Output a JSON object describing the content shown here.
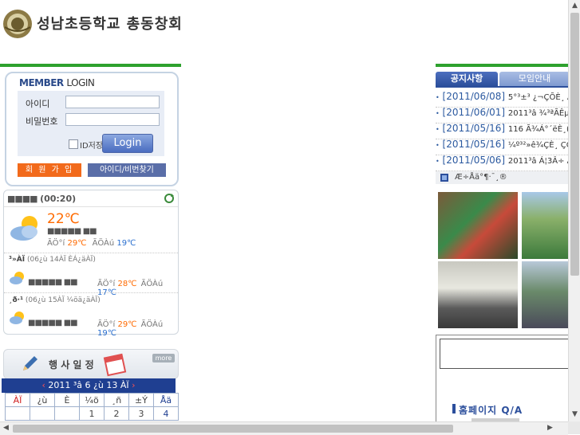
{
  "header": {
    "site_title": "성남초등학교 총동창회"
  },
  "login": {
    "title_member": "MEMBER",
    "title_login": "LOGIN",
    "id_label": "아이디",
    "pw_label": "비밀번호",
    "save_id_label": "ID저장",
    "login_button": "Login",
    "join_button": "회 원 가 입",
    "find_button": "아이디/비번찾기"
  },
  "weather": {
    "header_label": "■■■■",
    "header_time": "(00:20)",
    "today": {
      "temp": "22℃",
      "desc": "■■■■■ ■■",
      "hi_label": "ÃÖ°í",
      "hi": "29℃",
      "lo_label": "ÃÖÀú",
      "lo": "19℃"
    },
    "forecast": [
      {
        "day_label": "³»ÀÏ",
        "date_text": "(06¿ù 14ÀÏ ÈÁ¿äÀÏ)",
        "desc": "■■■■■ ■■",
        "hi_label": "ÃÖ°í",
        "hi": "28℃",
        "lo_label": "ÃÖÀú",
        "lo": "17℃"
      },
      {
        "day_label": "¸ð·¹",
        "date_text": "(06¿ù 15ÀÏ ¼öä¿äÀÏ)",
        "desc": "■■■■■ ■■",
        "hi_label": "ÃÖ°í",
        "hi": "29℃",
        "lo_label": "ÃÖÀú",
        "lo": "19℃"
      }
    ]
  },
  "schedule": {
    "title": "행 사 일 정",
    "more": "more",
    "calendar_title": "2011 ³â 6 ¿ù 13 ÀÏ",
    "weekdays": [
      "ÀÏ",
      "¿ù",
      "È",
      "¼ö",
      "¸ñ",
      "±Ý",
      "Åä"
    ],
    "first_row": [
      "",
      "",
      "",
      "1",
      "2",
      "3",
      "4"
    ]
  },
  "notice": {
    "tab_notice": "공지사항",
    "tab_meeting": "모임안내",
    "items": [
      {
        "date": "[2011/06/08]",
        "text": "5°³±³ ¿¬ÇÕÈ¸ Ã"
      },
      {
        "date": "[2011/06/01]",
        "text": "2011³â ¾³ªÃÊµî"
      },
      {
        "date": "[2011/05/16]",
        "text": "116 Ã¾Á°´ëÈ¸(1"
      },
      {
        "date": "[2011/05/16]",
        "text": "¼º³²»ê¾ÇÈ¸ ÇÕÁ"
      },
      {
        "date": "[2011/05/06]",
        "text": "2011³â Á¦3Â÷ ÀÓ"
      }
    ],
    "board_label": "Æ÷Åä°¶·¯¸®"
  },
  "qa": {
    "title": "홈페이지 Q/A"
  },
  "colors": {
    "green_line": "#2ea12e",
    "tab_active": "#2c4f9c",
    "join_orange": "#f26a1b",
    "calendar_blue": "#1f3f91"
  }
}
